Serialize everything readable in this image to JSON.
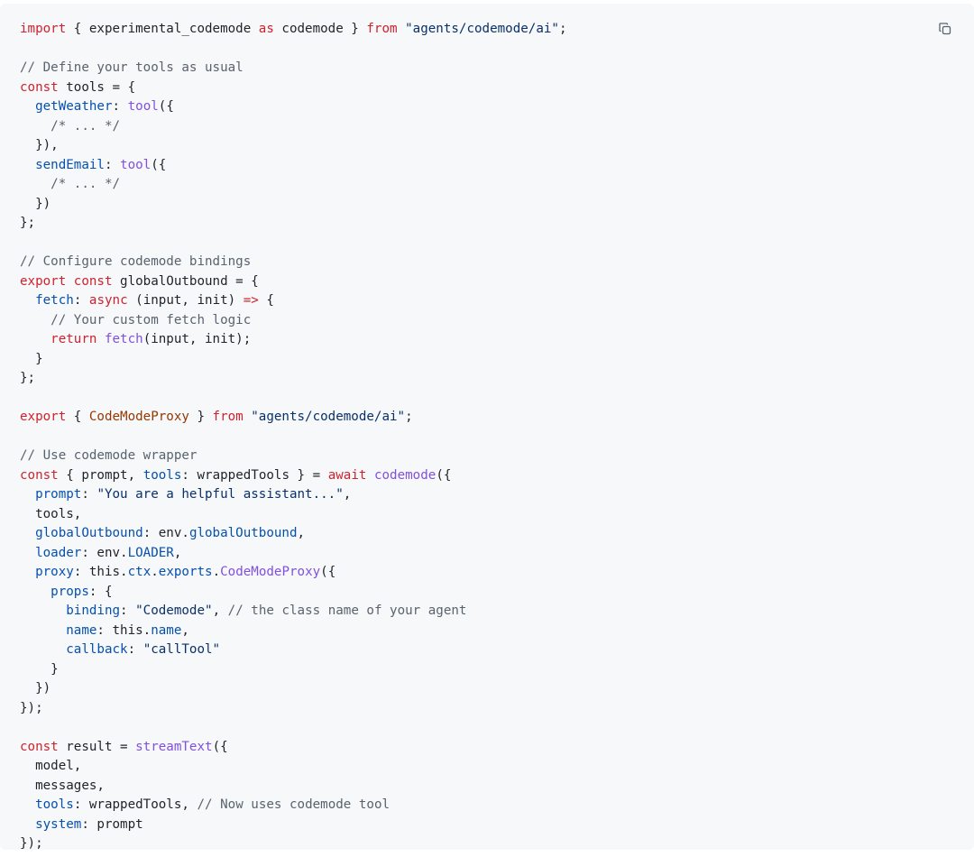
{
  "code_block": {
    "language": "javascript",
    "copy_button": {
      "icon": "copy-icon"
    },
    "colors": {
      "background": "#f6f8fa",
      "keyword": "#cf222e",
      "comment": "#59636e",
      "string": "#0a3069",
      "function": "#8250df",
      "property": "#0550ae",
      "class": "#953800",
      "plain": "#1f2328"
    },
    "lines": [
      [
        [
          "keyword",
          "import"
        ],
        [
          "plain",
          " { experimental_codemode "
        ],
        [
          "keyword",
          "as"
        ],
        [
          "plain",
          " codemode } "
        ],
        [
          "keyword",
          "from"
        ],
        [
          "plain",
          " "
        ],
        [
          "string",
          "\"agents/codemode/ai\""
        ],
        [
          "plain",
          ";"
        ]
      ],
      [],
      [
        [
          "comment",
          "// Define your tools as usual"
        ]
      ],
      [
        [
          "keyword",
          "const"
        ],
        [
          "plain",
          " tools = {"
        ]
      ],
      [
        [
          "plain",
          "  "
        ],
        [
          "property",
          "getWeather"
        ],
        [
          "plain",
          ": "
        ],
        [
          "function",
          "tool"
        ],
        [
          "plain",
          "({"
        ]
      ],
      [
        [
          "plain",
          "    "
        ],
        [
          "comment",
          "/* ... */"
        ]
      ],
      [
        [
          "plain",
          "  }),"
        ]
      ],
      [
        [
          "plain",
          "  "
        ],
        [
          "property",
          "sendEmail"
        ],
        [
          "plain",
          ": "
        ],
        [
          "function",
          "tool"
        ],
        [
          "plain",
          "({"
        ]
      ],
      [
        [
          "plain",
          "    "
        ],
        [
          "comment",
          "/* ... */"
        ]
      ],
      [
        [
          "plain",
          "  })"
        ]
      ],
      [
        [
          "plain",
          "};"
        ]
      ],
      [],
      [
        [
          "comment",
          "// Configure codemode bindings"
        ]
      ],
      [
        [
          "keyword",
          "export"
        ],
        [
          "plain",
          " "
        ],
        [
          "keyword",
          "const"
        ],
        [
          "plain",
          " globalOutbound = {"
        ]
      ],
      [
        [
          "plain",
          "  "
        ],
        [
          "property",
          "fetch"
        ],
        [
          "plain",
          ": "
        ],
        [
          "keyword",
          "async"
        ],
        [
          "plain",
          " (input, init) "
        ],
        [
          "keyword",
          "=>"
        ],
        [
          "plain",
          " {"
        ]
      ],
      [
        [
          "plain",
          "    "
        ],
        [
          "comment",
          "// Your custom fetch logic"
        ]
      ],
      [
        [
          "plain",
          "    "
        ],
        [
          "keyword",
          "return"
        ],
        [
          "plain",
          " "
        ],
        [
          "function",
          "fetch"
        ],
        [
          "plain",
          "(input, init);"
        ]
      ],
      [
        [
          "plain",
          "  }"
        ]
      ],
      [
        [
          "plain",
          "};"
        ]
      ],
      [],
      [
        [
          "keyword",
          "export"
        ],
        [
          "plain",
          " { "
        ],
        [
          "class",
          "CodeModeProxy"
        ],
        [
          "plain",
          " } "
        ],
        [
          "keyword",
          "from"
        ],
        [
          "plain",
          " "
        ],
        [
          "string",
          "\"agents/codemode/ai\""
        ],
        [
          "plain",
          ";"
        ]
      ],
      [],
      [
        [
          "comment",
          "// Use codemode wrapper"
        ]
      ],
      [
        [
          "keyword",
          "const"
        ],
        [
          "plain",
          " { prompt, "
        ],
        [
          "property",
          "tools"
        ],
        [
          "plain",
          ": wrappedTools } = "
        ],
        [
          "keyword",
          "await"
        ],
        [
          "plain",
          " "
        ],
        [
          "function",
          "codemode"
        ],
        [
          "plain",
          "({"
        ]
      ],
      [
        [
          "plain",
          "  "
        ],
        [
          "property",
          "prompt"
        ],
        [
          "plain",
          ": "
        ],
        [
          "string",
          "\"You are a helpful assistant...\""
        ],
        [
          "plain",
          ","
        ]
      ],
      [
        [
          "plain",
          "  tools,"
        ]
      ],
      [
        [
          "plain",
          "  "
        ],
        [
          "property",
          "globalOutbound"
        ],
        [
          "plain",
          ": env."
        ],
        [
          "property",
          "globalOutbound"
        ],
        [
          "plain",
          ","
        ]
      ],
      [
        [
          "plain",
          "  "
        ],
        [
          "property",
          "loader"
        ],
        [
          "plain",
          ": env."
        ],
        [
          "property",
          "LOADER"
        ],
        [
          "plain",
          ","
        ]
      ],
      [
        [
          "plain",
          "  "
        ],
        [
          "property",
          "proxy"
        ],
        [
          "plain",
          ": this."
        ],
        [
          "property",
          "ctx"
        ],
        [
          "plain",
          "."
        ],
        [
          "property",
          "exports"
        ],
        [
          "plain",
          "."
        ],
        [
          "function",
          "CodeModeProxy"
        ],
        [
          "plain",
          "({"
        ]
      ],
      [
        [
          "plain",
          "    "
        ],
        [
          "property",
          "props"
        ],
        [
          "plain",
          ": {"
        ]
      ],
      [
        [
          "plain",
          "      "
        ],
        [
          "property",
          "binding"
        ],
        [
          "plain",
          ": "
        ],
        [
          "string",
          "\"Codemode\""
        ],
        [
          "plain",
          ", "
        ],
        [
          "comment",
          "// the class name of your agent"
        ]
      ],
      [
        [
          "plain",
          "      "
        ],
        [
          "property",
          "name"
        ],
        [
          "plain",
          ": this."
        ],
        [
          "property",
          "name"
        ],
        [
          "plain",
          ","
        ]
      ],
      [
        [
          "plain",
          "      "
        ],
        [
          "property",
          "callback"
        ],
        [
          "plain",
          ": "
        ],
        [
          "string",
          "\"callTool\""
        ]
      ],
      [
        [
          "plain",
          "    }"
        ]
      ],
      [
        [
          "plain",
          "  })"
        ]
      ],
      [
        [
          "plain",
          "});"
        ]
      ],
      [],
      [
        [
          "keyword",
          "const"
        ],
        [
          "plain",
          " result = "
        ],
        [
          "function",
          "streamText"
        ],
        [
          "plain",
          "({"
        ]
      ],
      [
        [
          "plain",
          "  model,"
        ]
      ],
      [
        [
          "plain",
          "  messages,"
        ]
      ],
      [
        [
          "plain",
          "  "
        ],
        [
          "property",
          "tools"
        ],
        [
          "plain",
          ": wrappedTools, "
        ],
        [
          "comment",
          "// Now uses codemode tool"
        ]
      ],
      [
        [
          "plain",
          "  "
        ],
        [
          "property",
          "system"
        ],
        [
          "plain",
          ": prompt"
        ]
      ],
      [
        [
          "plain",
          "});"
        ]
      ]
    ]
  }
}
